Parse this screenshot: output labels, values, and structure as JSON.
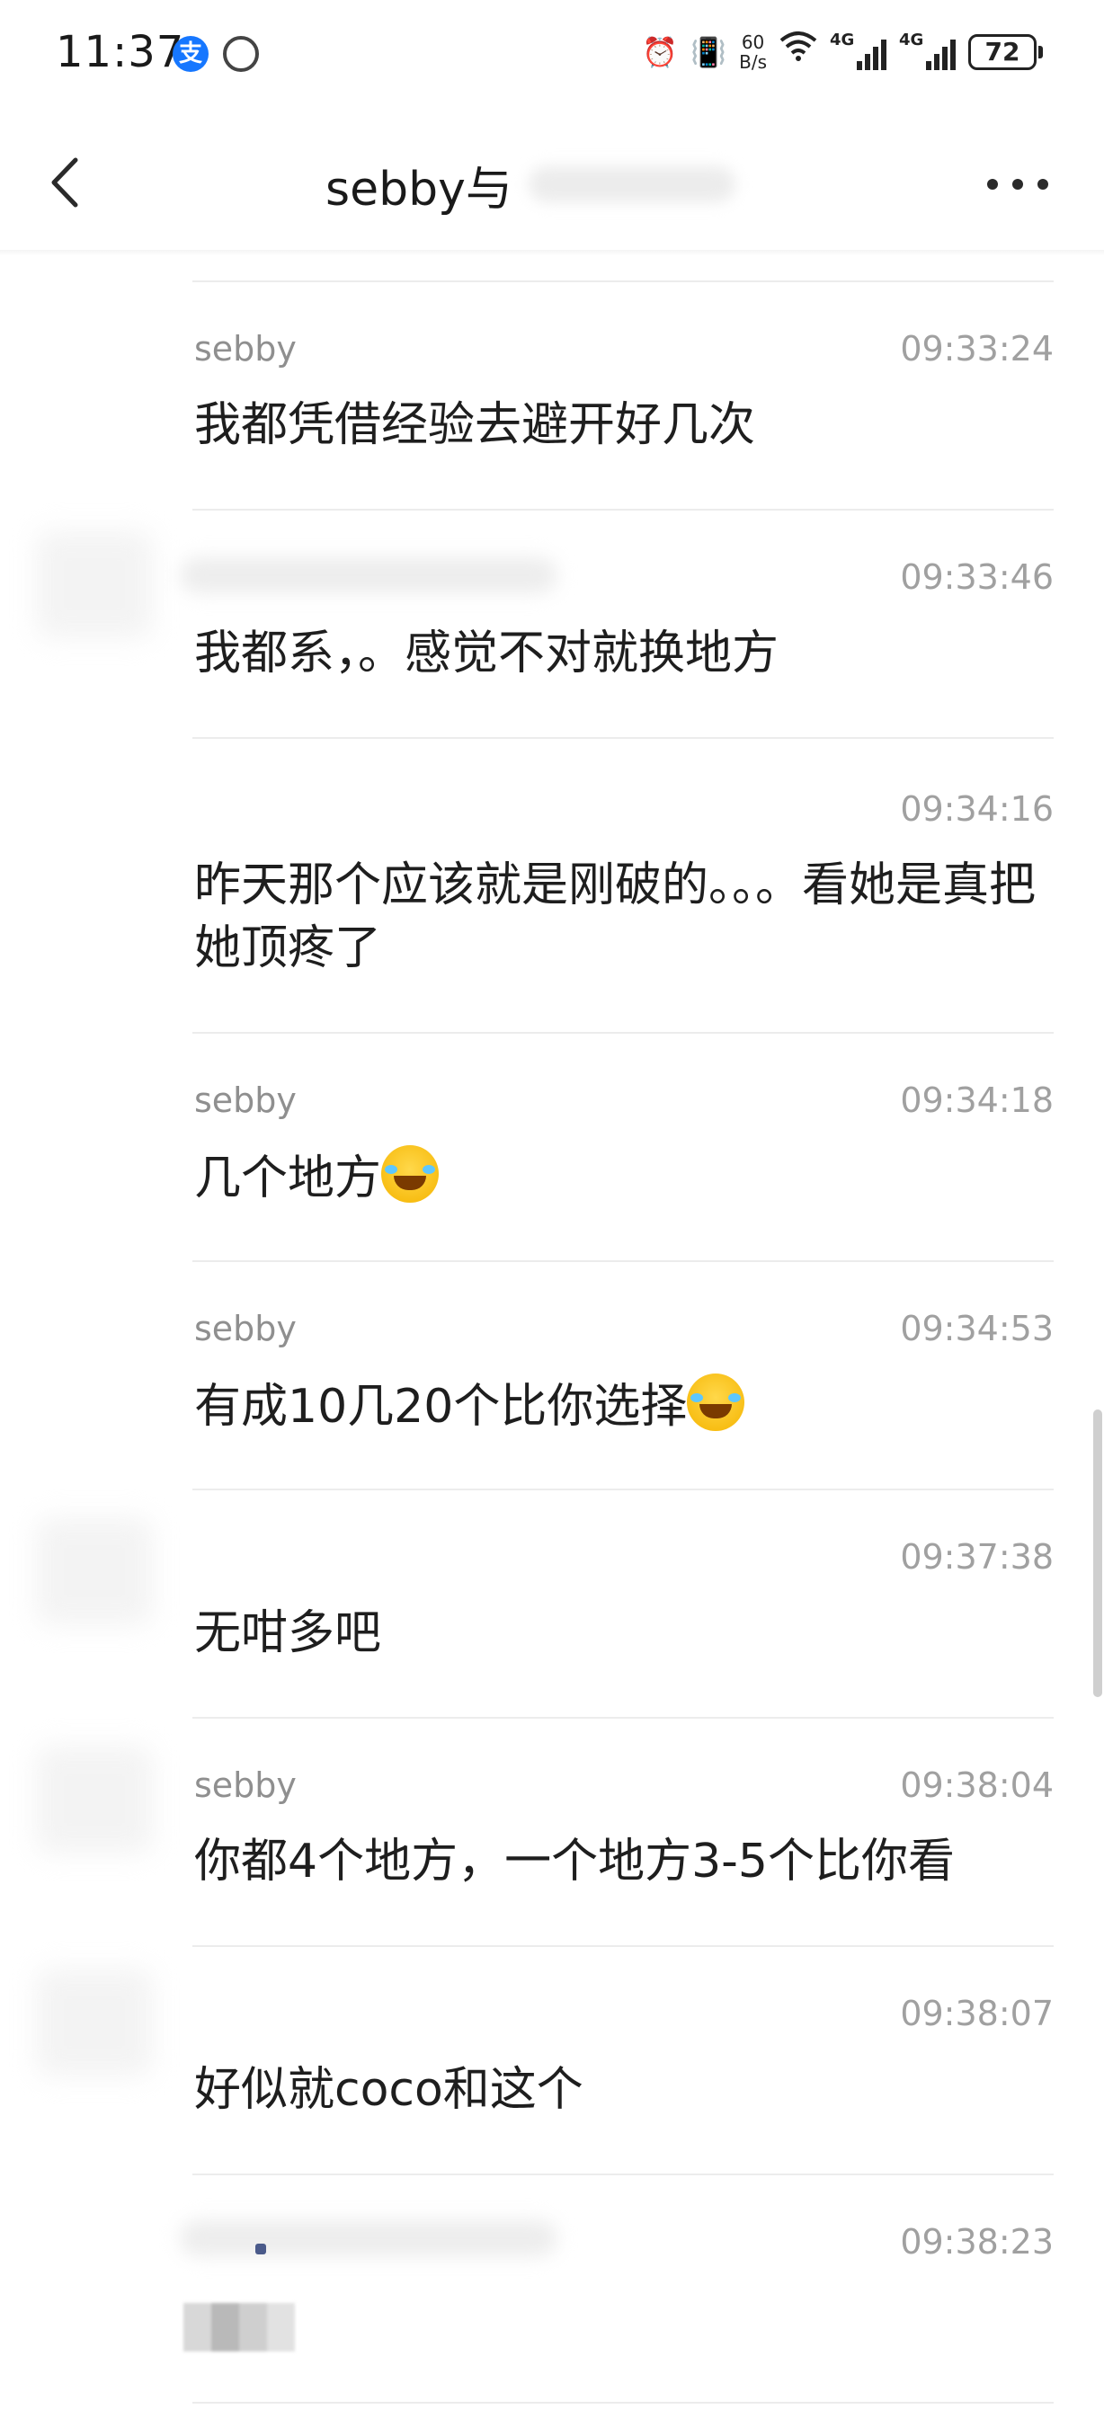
{
  "status_bar": {
    "time": "11:37",
    "app_icons": [
      "alipay-icon",
      "app-icon"
    ],
    "net_speed_value": "60",
    "net_speed_unit": "B/s",
    "signal1_label": "4G",
    "signal2_label": "4G",
    "battery": "72",
    "icons": [
      "alarm-icon",
      "vibrate-icon",
      "wifi-icon",
      "signal-icon",
      "battery-icon"
    ]
  },
  "header": {
    "title": "sebby与"
  },
  "messages": [
    {
      "sender": "sebby",
      "time": "09:33:24",
      "text": "我都凭借经验去避开好几次"
    },
    {
      "sender": "",
      "time": "09:33:46",
      "text": "我都系，。感觉不对就换地方"
    },
    {
      "sender": "",
      "time": "09:34:16",
      "text": "昨天那个应该就是刚破的。。。看她是真把她顶疼了"
    },
    {
      "sender": "sebby",
      "time": "09:34:18",
      "text": "几个地方"
    },
    {
      "sender": "sebby",
      "time": "09:34:53",
      "text": "有成10几20个比你选择"
    },
    {
      "sender": "",
      "time": "09:37:38",
      "text": "无咁多吧"
    },
    {
      "sender": "sebby",
      "time": "09:38:04",
      "text": "你都4个地方，一个地方3-5个比你看"
    },
    {
      "sender": "",
      "time": "09:38:07",
      "text": "好似就coco和这个"
    },
    {
      "sender": "",
      "time": "09:38:23",
      "text": ""
    }
  ],
  "colors": {
    "background": "#ffffff",
    "text": "#1e1e1e",
    "meta": "#a0a0a0",
    "divider": "#ececec"
  }
}
